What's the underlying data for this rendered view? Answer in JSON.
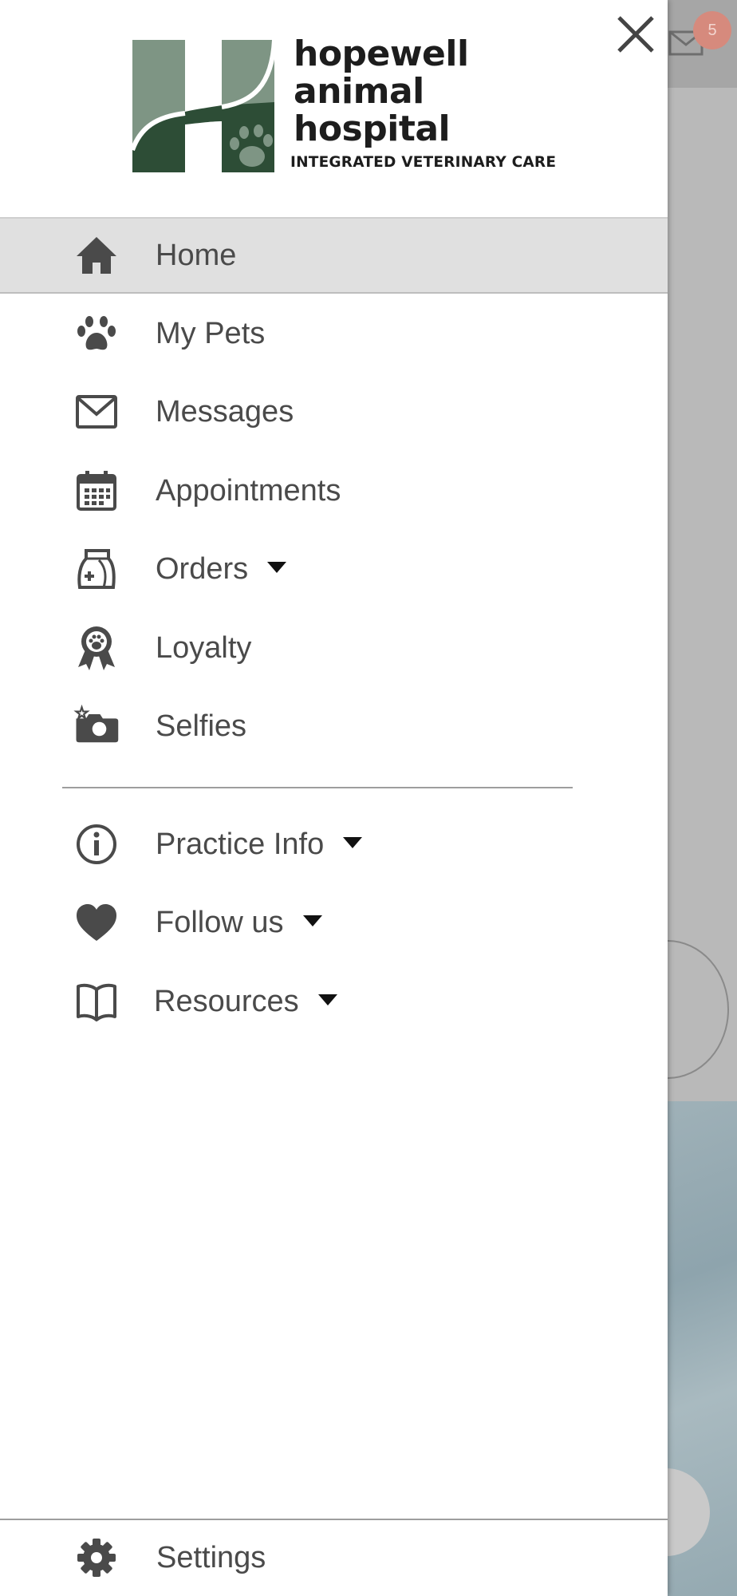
{
  "background": {
    "badge_count": "5"
  },
  "drawer": {
    "logo": {
      "line1": "hopewell",
      "line2": "animal",
      "line3": "hospital",
      "tagline": "INTEGRATED VETERINARY CARE",
      "colors": {
        "dark_green": "#2d4d36",
        "light_green": "#7e9584"
      }
    },
    "close_icon": "close-icon",
    "menu": [
      {
        "label": "Home",
        "icon": "home-icon",
        "active": true
      },
      {
        "label": "My Pets",
        "icon": "paw-icon"
      },
      {
        "label": "Messages",
        "icon": "envelope-icon"
      },
      {
        "label": "Appointments",
        "icon": "calendar-icon"
      },
      {
        "label": "Orders",
        "icon": "food-bag-icon",
        "dropdown": true
      },
      {
        "label": "Loyalty",
        "icon": "award-ribbon-icon"
      },
      {
        "label": "Selfies",
        "icon": "camera-icon"
      }
    ],
    "secondary_menu": [
      {
        "label": "Practice Info",
        "icon": "info-icon",
        "dropdown": true
      },
      {
        "label": "Follow us",
        "icon": "heart-icon",
        "dropdown": true
      },
      {
        "label": "Resources",
        "icon": "book-icon",
        "dropdown": true
      }
    ],
    "settings": {
      "label": "Settings",
      "icon": "gear-icon"
    },
    "colors": {
      "icon": "#4a4a4a",
      "text": "#4a4a4a",
      "active_bg": "#e0e0e0"
    }
  }
}
